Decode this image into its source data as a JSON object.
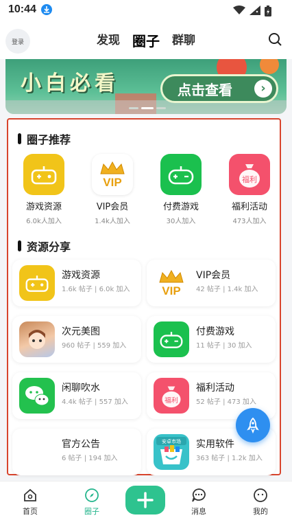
{
  "status_bar": {
    "time": "10:44"
  },
  "header": {
    "login_label": "登录",
    "tabs": [
      "发现",
      "圈子",
      "群聊"
    ],
    "active_tab": "圈子"
  },
  "banner": {
    "title": "小白必看",
    "button_label": "点击查看"
  },
  "recommend": {
    "title": "圈子推荐",
    "items": [
      {
        "name": "游戏资源",
        "joined": "6.0k人加入",
        "icon": "gamepad-icon"
      },
      {
        "name": "VIP会员",
        "joined": "1.4k人加入",
        "icon": "vip-crown-icon"
      },
      {
        "name": "付费游戏",
        "joined": "30人加入",
        "icon": "gamepad-green-icon"
      },
      {
        "name": "福利活动",
        "joined": "473人加入",
        "icon": "money-bag-icon"
      }
    ]
  },
  "resources": {
    "title": "资源分享",
    "items": [
      {
        "name": "游戏资源",
        "stats": "1.6k 帖子 | 6.0k 加入",
        "icon": "gamepad-icon"
      },
      {
        "name": "VIP会员",
        "stats": "42 帖子 | 1.4k 加入",
        "icon": "vip-crown-icon"
      },
      {
        "name": "次元美图",
        "stats": "960 帖子 | 559 加入",
        "icon": "anime-girl-icon"
      },
      {
        "name": "付费游戏",
        "stats": "11 帖子 | 30 加入",
        "icon": "gamepad-green-icon"
      },
      {
        "name": "闲聊吹水",
        "stats": "4.4k 帖子 | 557 加入",
        "icon": "chat-bubbles-icon"
      },
      {
        "name": "福利活动",
        "stats": "52 帖子 | 473 加入",
        "icon": "money-bag-icon"
      },
      {
        "name": "官方公告",
        "stats": "6 帖子 | 194 加入",
        "icon": "announcement-icon"
      },
      {
        "name": "实用软件",
        "stats": "363 帖子 | 1.2k 加入",
        "icon": "app-market-icon"
      }
    ]
  },
  "app_market_label": "安卓市场",
  "vip_text": "VIP",
  "fuli_text": "福利",
  "nav": {
    "items": [
      "首页",
      "圈子",
      "消息",
      "我的"
    ],
    "active": "圈子"
  },
  "colors": {
    "accent": "#2ec38f",
    "highlight_border": "#d8442c",
    "fab": "#2e8ff0"
  }
}
